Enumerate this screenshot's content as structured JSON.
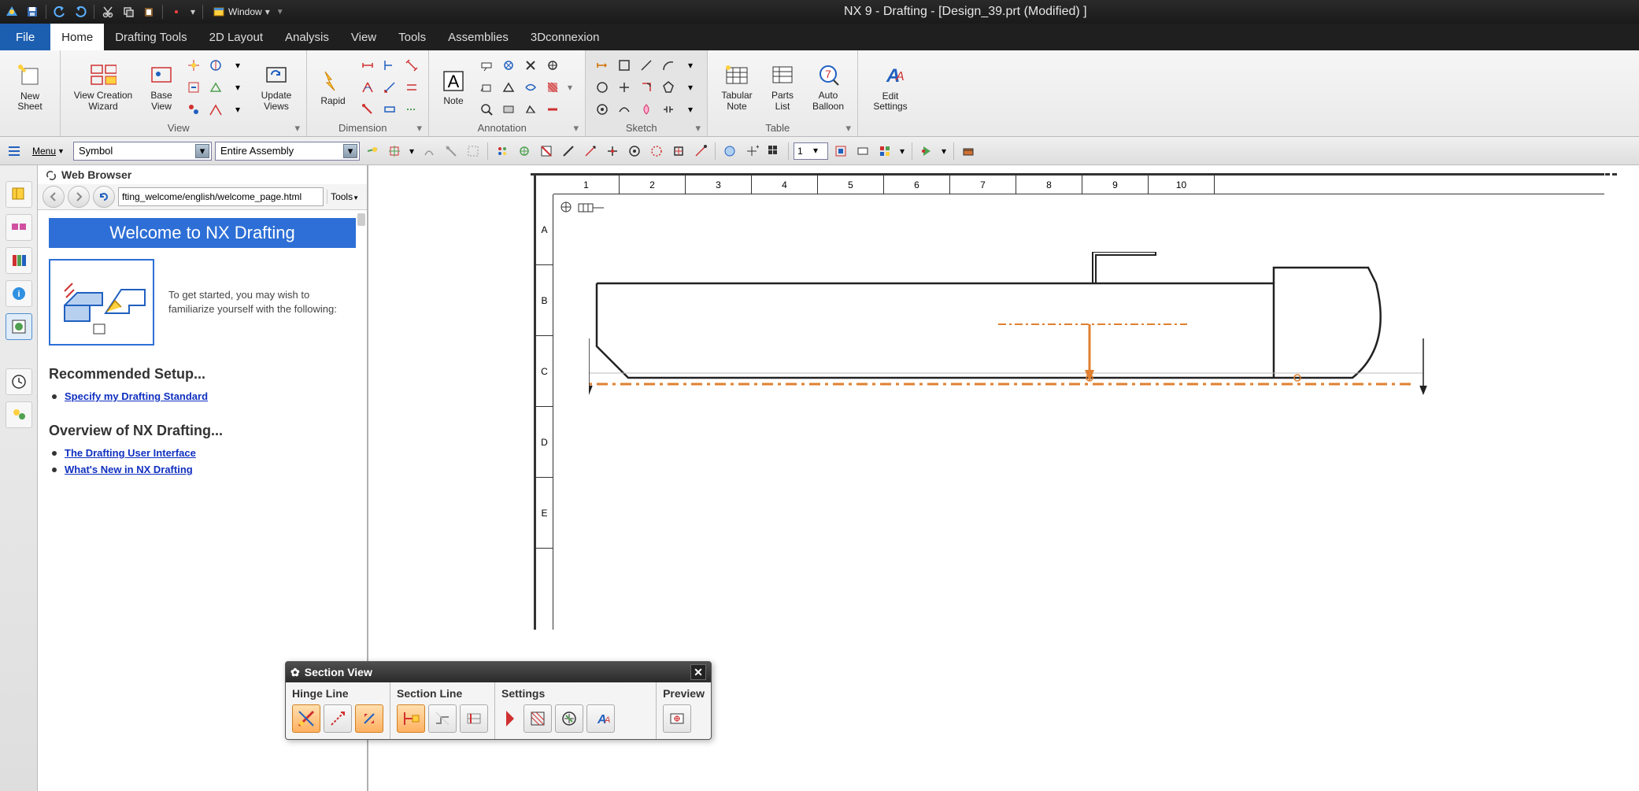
{
  "title": "NX 9 - Drafting - [Design_39.prt (Modified) ]",
  "window_menu": "Window",
  "tabs": {
    "file": "File",
    "items": [
      "Home",
      "Drafting Tools",
      "2D Layout",
      "Analysis",
      "View",
      "Tools",
      "Assemblies",
      "3Dconnexion"
    ],
    "active": 0
  },
  "ribbon": {
    "new_sheet": "New\nSheet",
    "view_wizard": "View Creation\nWizard",
    "base_view": "Base\nView",
    "update_views": "Update\nViews",
    "rapid": "Rapid",
    "note": "Note",
    "tabular_note": "Tabular\nNote",
    "parts_list": "Parts\nList",
    "auto_balloon": "Auto\nBalloon",
    "edit_settings": "Edit\nSettings",
    "groups": {
      "view": "View",
      "dimension": "Dimension",
      "annotation": "Annotation",
      "sketch": "Sketch",
      "table": "Table"
    }
  },
  "toolbar2": {
    "menu": "Menu",
    "combo1": "Symbol",
    "combo2": "Entire Assembly",
    "number": "1"
  },
  "browser": {
    "title": "Web Browser",
    "address": "fting_welcome/english/welcome_page.html",
    "tools": "Tools",
    "banner": "Welcome to NX Drafting",
    "intro": "To get started, you may wish to familiarize yourself with the following:",
    "rec_title": "Recommended Setup...",
    "rec_link": "Specify my Drafting Standard",
    "ov_title": "Overview of NX Drafting...",
    "ov_links": [
      "The Drafting User Interface",
      "What's New in NX Drafting"
    ]
  },
  "drawing": {
    "cols": [
      "1",
      "2",
      "3",
      "4",
      "5",
      "6",
      "7",
      "8",
      "9",
      "10"
    ],
    "rows": [
      "A",
      "B",
      "C",
      "D",
      "E"
    ]
  },
  "dialog": {
    "title": "Section View",
    "groups": {
      "hinge": "Hinge Line",
      "section": "Section Line",
      "settings": "Settings",
      "preview": "Preview"
    }
  }
}
